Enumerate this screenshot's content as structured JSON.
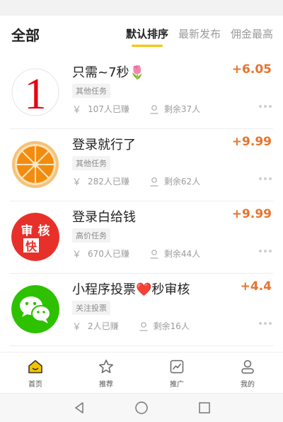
{
  "header": {
    "title": "全部",
    "tabs": [
      {
        "label": "默认排序",
        "active": true
      },
      {
        "label": "最新发布",
        "active": false
      },
      {
        "label": "佣金最高",
        "active": false
      }
    ]
  },
  "tasks": [
    {
      "name": "只需~7秒🌷",
      "price": "+6.05",
      "tag": "其他任务",
      "yen": "￥",
      "earned": "107人已赚",
      "remaining": "剩余37人",
      "avatar_icon": "red-number-one-icon",
      "avatar_text": "1"
    },
    {
      "name": "登录就行了",
      "price": "+9.99",
      "tag": "其他任务",
      "yen": "￥",
      "earned": "282人已赚",
      "remaining": "剩余62人",
      "avatar_icon": "orange-slice-icon"
    },
    {
      "name": "登录白给钱",
      "price": "+9.99",
      "tag": "高价任务",
      "yen": "￥",
      "earned": "670人已赚",
      "remaining": "剩余44人",
      "avatar_icon": "review-fast-badge-icon",
      "avatar_text_1": "审",
      "avatar_text_2": "核",
      "avatar_text_3": "快"
    },
    {
      "name": "小程序投票❤️秒审核",
      "price": "+4.4",
      "tag": "关注投票",
      "yen": "￥",
      "earned": "2人已赚",
      "remaining": "剩余16人",
      "avatar_icon": "wechat-icon"
    }
  ],
  "tabbar": {
    "items": [
      {
        "label": "首页",
        "icon": "home-icon",
        "active": true
      },
      {
        "label": "推荐",
        "icon": "star-icon",
        "active": false
      },
      {
        "label": "推广",
        "icon": "promote-chart-icon",
        "active": false
      },
      {
        "label": "我的",
        "icon": "user-icon",
        "active": false
      }
    ]
  },
  "colors": {
    "accent": "#f5c400",
    "price": "#e8742c",
    "tag_bg": "#f3f3f3"
  }
}
